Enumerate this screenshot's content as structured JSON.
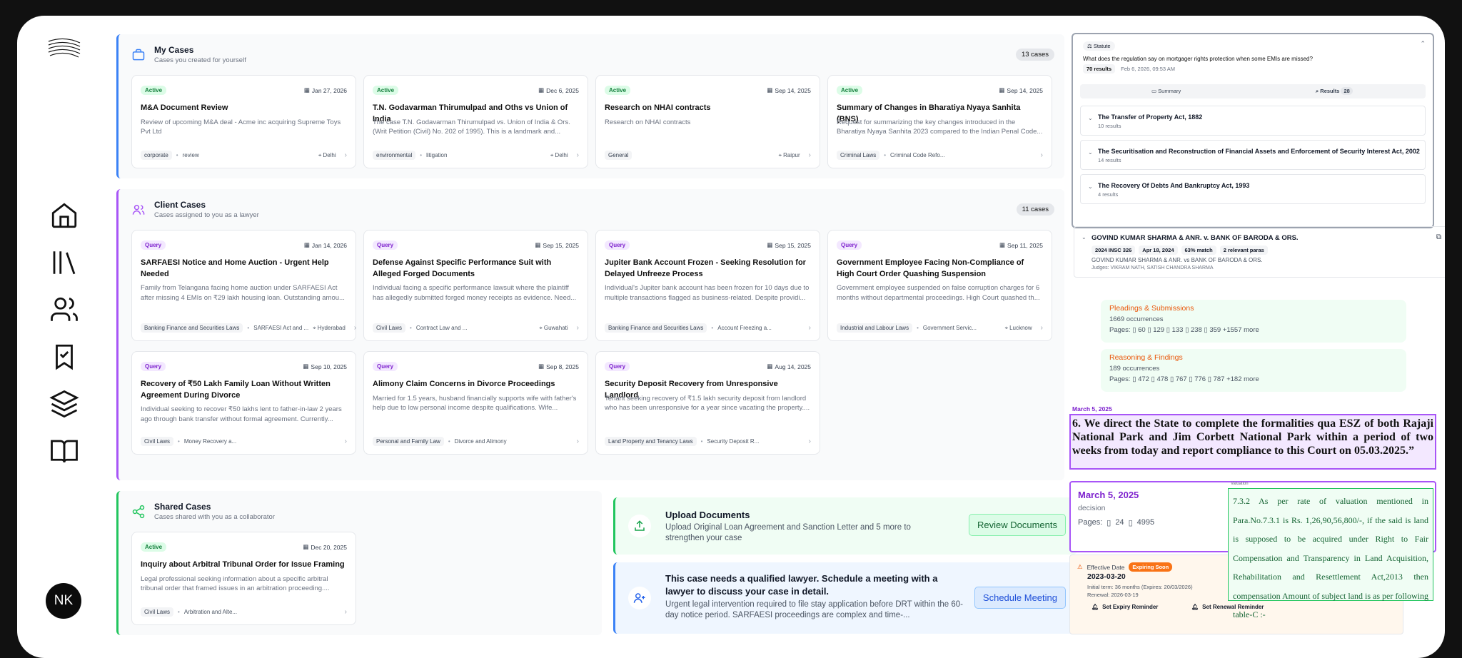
{
  "user": {
    "initials": "NK"
  },
  "my_cases": {
    "title": "My Cases",
    "subtitle": "Cases you created for yourself",
    "count": "13 cases",
    "cards": [
      {
        "status": "Active",
        "date": "Jan 27, 2026",
        "title": "M&A Document Review",
        "desc": "Review of upcoming M&A deal - Acme inc acquiring Supreme Toys Pvt Ltd",
        "tags": [
          "corporate",
          "review"
        ],
        "location": "Delhi"
      },
      {
        "status": "Active",
        "date": "Dec 6, 2025",
        "title": "T.N. Godavarman Thirumulpad and Oths vs Union of India",
        "desc": "The case T.N. Godavarman Thirumulpad vs. Union of India & Ors. (Writ Petition (Civil) No. 202 of 1995). This is a landmark and...",
        "tags": [
          "environmental",
          "litigation"
        ],
        "location": "Delhi"
      },
      {
        "status": "Active",
        "date": "Sep 14, 2025",
        "title": "Research on NHAI contracts",
        "desc": "Research on NHAI contracts",
        "tags": [
          "General"
        ],
        "location": "Raipur"
      },
      {
        "status": "Active",
        "date": "Sep 14, 2025",
        "title": "Summary of Changes in Bharatiya Nyaya Sanhita (BNS)",
        "desc": "Request for summarizing the key changes introduced in the Bharatiya Nyaya Sanhita 2023 compared to the Indian Penal Code...",
        "tags": [
          "Criminal Laws",
          "Criminal Code Refo..."
        ],
        "location": ""
      }
    ]
  },
  "client_cases": {
    "title": "Client Cases",
    "subtitle": "Cases assigned to you as a lawyer",
    "count": "11 cases",
    "cards": [
      {
        "status": "Query",
        "date": "Jan 14, 2026",
        "title": "SARFAESI Notice and Home Auction - Urgent Help Needed",
        "desc": "Family from Telangana facing home auction under SARFAESI Act after missing 4 EMIs on ₹29 lakh housing loan. Outstanding amou...",
        "tags": [
          "Banking Finance and Securities Laws",
          "SARFAESI Act and ..."
        ],
        "location": "Hyderabad"
      },
      {
        "status": "Query",
        "date": "Sep 15, 2025",
        "title": "Defense Against Specific Performance Suit with Alleged Forged Documents",
        "desc": "Individual facing a specific performance lawsuit where the plaintiff has allegedly submitted forged money receipts as evidence. Need...",
        "tags": [
          "Civil Laws",
          "Contract Law and ..."
        ],
        "location": "Guwahati"
      },
      {
        "status": "Query",
        "date": "Sep 15, 2025",
        "title": "Jupiter Bank Account Frozen - Seeking Resolution for Delayed Unfreeze Process",
        "desc": "Individual's Jupiter bank account has been frozen for 10 days due to multiple transactions flagged as business-related. Despite providi...",
        "tags": [
          "Banking Finance and Securities Laws",
          "Account Freezing a..."
        ],
        "location": ""
      },
      {
        "status": "Query",
        "date": "Sep 11, 2025",
        "title": "Government Employee Facing Non-Compliance of High Court Order Quashing Suspension",
        "desc": "Government employee suspended on false corruption charges for 6 months without departmental proceedings. High Court quashed th...",
        "tags": [
          "Industrial and Labour Laws",
          "Government Servic..."
        ],
        "location": "Lucknow"
      },
      {
        "status": "Query",
        "date": "Sep 10, 2025",
        "title": "Recovery of ₹50 Lakh Family Loan Without Written Agreement During Divorce",
        "desc": "Individual seeking to recover ₹50 lakhs lent to father-in-law 2 years ago through bank transfer without formal agreement. Currently...",
        "tags": [
          "Civil Laws",
          "Money Recovery a..."
        ],
        "location": ""
      },
      {
        "status": "Query",
        "date": "Sep 8, 2025",
        "title": "Alimony Claim Concerns in Divorce Proceedings",
        "desc": "Married for 1.5 years, husband financially supports wife with father's help due to low personal income despite qualifications. Wife...",
        "tags": [
          "Personal and Family Law",
          "Divorce and Alimony"
        ],
        "location": ""
      },
      {
        "status": "Query",
        "date": "Aug 14, 2025",
        "title": "Security Deposit Recovery from Unresponsive Landlord",
        "desc": "Tenant seeking recovery of ₹1.5 lakh security deposit from landlord who has been unresponsive for a year since vacating the property....",
        "tags": [
          "Land Property and Tenancy Laws",
          "Security Deposit R..."
        ],
        "location": ""
      }
    ]
  },
  "shared_cases": {
    "title": "Shared Cases",
    "subtitle": "Cases shared with you as a collaborator",
    "cards": [
      {
        "status": "Active",
        "date": "Dec 20, 2025",
        "title": "Inquiry about Arbitral Tribunal Order for Issue Framing",
        "desc": "Legal professional seeking information about a specific arbitral tribunal order that framed issues in an arbitration proceeding....",
        "tags": [
          "Civil Laws",
          "Arbitration and Alte..."
        ],
        "location": ""
      }
    ]
  },
  "actions": {
    "upload": {
      "title": "Upload Documents",
      "desc": "Upload Original Loan Agreement and Sanction Letter and 5 more to strengthen your case",
      "button": "Review Documents"
    },
    "lawyer": {
      "title": "This case needs a qualified lawyer. Schedule a meeting with a lawyer to discuss your case in detail.",
      "desc": "Urgent legal intervention required to file stay application before DRT within the 60-day notice period. SARFAESI proceedings are complex and time-...",
      "button": "Schedule Meeting"
    }
  },
  "statute": {
    "tag": "Statute",
    "question": "What does the regulation say on mortgager rights protection when some EMIs are missed?",
    "results": "70 results",
    "timestamp": "Feb 6, 2026, 09:53 AM",
    "tab_summary": "Summary",
    "tab_results": "Results",
    "results_count": "28",
    "laws": [
      {
        "title": "The Transfer of Property Act, 1882",
        "sub": "10 results"
      },
      {
        "title": "The Securitisation and Reconstruction of Financial Assets and Enforcement of Security Interest Act, 2002",
        "sub": "14 results"
      },
      {
        "title": "The Recovery Of Debts And Bankruptcy Act, 1993",
        "sub": "4 results"
      }
    ]
  },
  "judgment": {
    "title": "GOVIND KUMAR SHARMA & ANR. v. BANK OF BARODA & ORS.",
    "citation": "2024 INSC 326",
    "date": "Apr 18, 2024",
    "match": "63% match",
    "paras": "2 relevant paras",
    "parties": "GOVIND KUMAR SHARMA & ANR. vs BANK OF BARODA & ORS.",
    "judges": "Judges: VIKRAM NATH, SATISH CHANDRA SHARMA"
  },
  "occurrences": [
    {
      "title": "Pleadings & Submissions",
      "count": "1669 occurrences",
      "pages_label": "Pages:",
      "pages": [
        "60",
        "129",
        "133",
        "238",
        "359"
      ],
      "more": "+1557 more"
    },
    {
      "title": "Reasoning & Findings",
      "count": "189 occurrences",
      "pages_label": "Pages:",
      "pages": [
        "472",
        "478",
        "767",
        "776",
        "787"
      ],
      "more": "+182 more"
    }
  ],
  "excerpt": {
    "date": "March 5, 2025",
    "text": "6. We direct the State to complete the formalities qua ESZ of both Rajaji National Park and Jim Corbett National Park within a period of two weeks from today and report compliance to this Court on 05.03.2025.”"
  },
  "decision": {
    "date": "March 5, 2025",
    "label": "decision",
    "pages_label": "Pages:",
    "pages": [
      "24",
      "4995"
    ]
  },
  "valuation": {
    "tag": "Valuation",
    "text": "7.3.2 As per rate of valuation mentioned in Para.No.7.3.1 is Rs. 1,26,90,56,800/-, if the said is land is supposed to be acquired under Right to Fair Compensation and Transparency in Land Acquisition, Rehabilitation and Resettlement Act,2013 then compensation Amount of subject land is as per following table-C :-"
  },
  "expiry": {
    "label": "Effective Date",
    "badge": "Expiring Soon",
    "date": "2023-03-20",
    "initial": "Initial term: 36 months (Expires: 20/03/2026)",
    "renewal": "Renewal: 2026-03-19",
    "btn1": "Set Expiry Reminder",
    "btn2": "Set Renewal Reminder"
  }
}
